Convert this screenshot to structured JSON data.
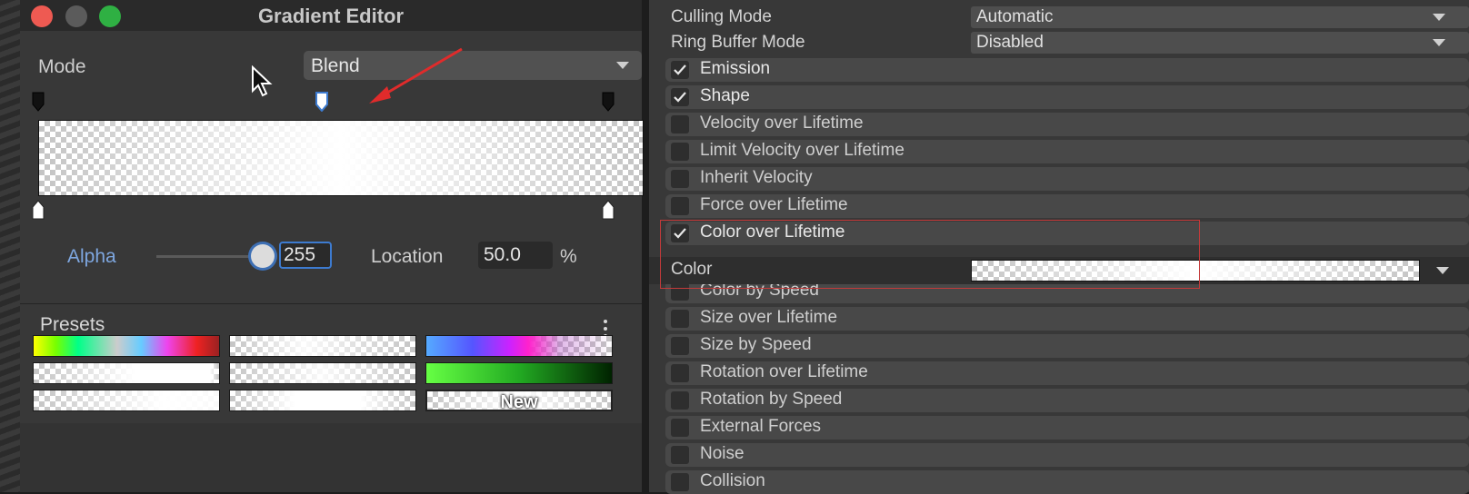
{
  "window": {
    "title": "Gradient Editor",
    "traffic_light_colors": [
      "#ee5a52",
      "#5b5b5b",
      "#2fb043"
    ]
  },
  "editor": {
    "mode_label": "Mode",
    "mode_value": "Blend",
    "alpha_label": "Alpha",
    "alpha_value": "255",
    "alpha_slider_level": 1.0,
    "location_label": "Location",
    "location_value": "50.0",
    "location_unit": "%",
    "presets_label": "Presets",
    "new_preset_label": "New",
    "accent_color": "#3d7bd0"
  },
  "inspector": {
    "culling_mode": {
      "label": "Culling Mode",
      "value": "Automatic"
    },
    "ring_buffer_mode": {
      "label": "Ring Buffer Mode",
      "value": "Disabled"
    },
    "color_property": {
      "label": "Color"
    },
    "modules": [
      {
        "label": "Emission",
        "checked": true
      },
      {
        "label": "Shape",
        "checked": true
      },
      {
        "label": "Velocity over Lifetime",
        "checked": false
      },
      {
        "label": "Limit Velocity over Lifetime",
        "checked": false
      },
      {
        "label": "Inherit Velocity",
        "checked": false
      },
      {
        "label": "Force over Lifetime",
        "checked": false
      },
      {
        "label": "Color over Lifetime",
        "checked": true
      },
      {
        "label": "Color by Speed",
        "checked": false
      },
      {
        "label": "Size over Lifetime",
        "checked": false
      },
      {
        "label": "Size by Speed",
        "checked": false
      },
      {
        "label": "Rotation over Lifetime",
        "checked": false
      },
      {
        "label": "Rotation by Speed",
        "checked": false
      },
      {
        "label": "External Forces",
        "checked": false
      },
      {
        "label": "Noise",
        "checked": false
      },
      {
        "label": "Collision",
        "checked": false
      }
    ],
    "highlight_color": "#c43a3a"
  }
}
